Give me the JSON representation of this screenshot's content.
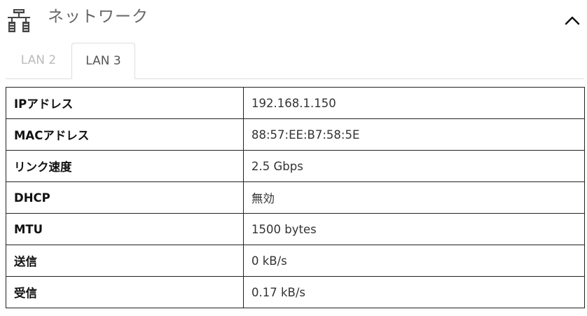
{
  "header": {
    "icon": "network-icon",
    "title": "ネットワーク",
    "collapse_icon": "chevron-up-icon"
  },
  "tabs": [
    {
      "label": "LAN 2",
      "active": false
    },
    {
      "label": "LAN 3",
      "active": true
    }
  ],
  "info": {
    "rows": [
      {
        "label": "IPアドレス",
        "value": "192.168.1.150"
      },
      {
        "label": "MACアドレス",
        "value": "88:57:EE:B7:58:5E"
      },
      {
        "label": "リンク速度",
        "value": "2.5 Gbps"
      },
      {
        "label": "DHCP",
        "value": "無効"
      },
      {
        "label": "MTU",
        "value": "1500 bytes"
      },
      {
        "label": "送信",
        "value": "0 kB/s"
      },
      {
        "label": "受信",
        "value": "0.17 kB/s"
      }
    ]
  },
  "colors": {
    "title_text": "#666666",
    "inactive_tab_text": "#bbbbbb",
    "table_border": "#222222"
  }
}
